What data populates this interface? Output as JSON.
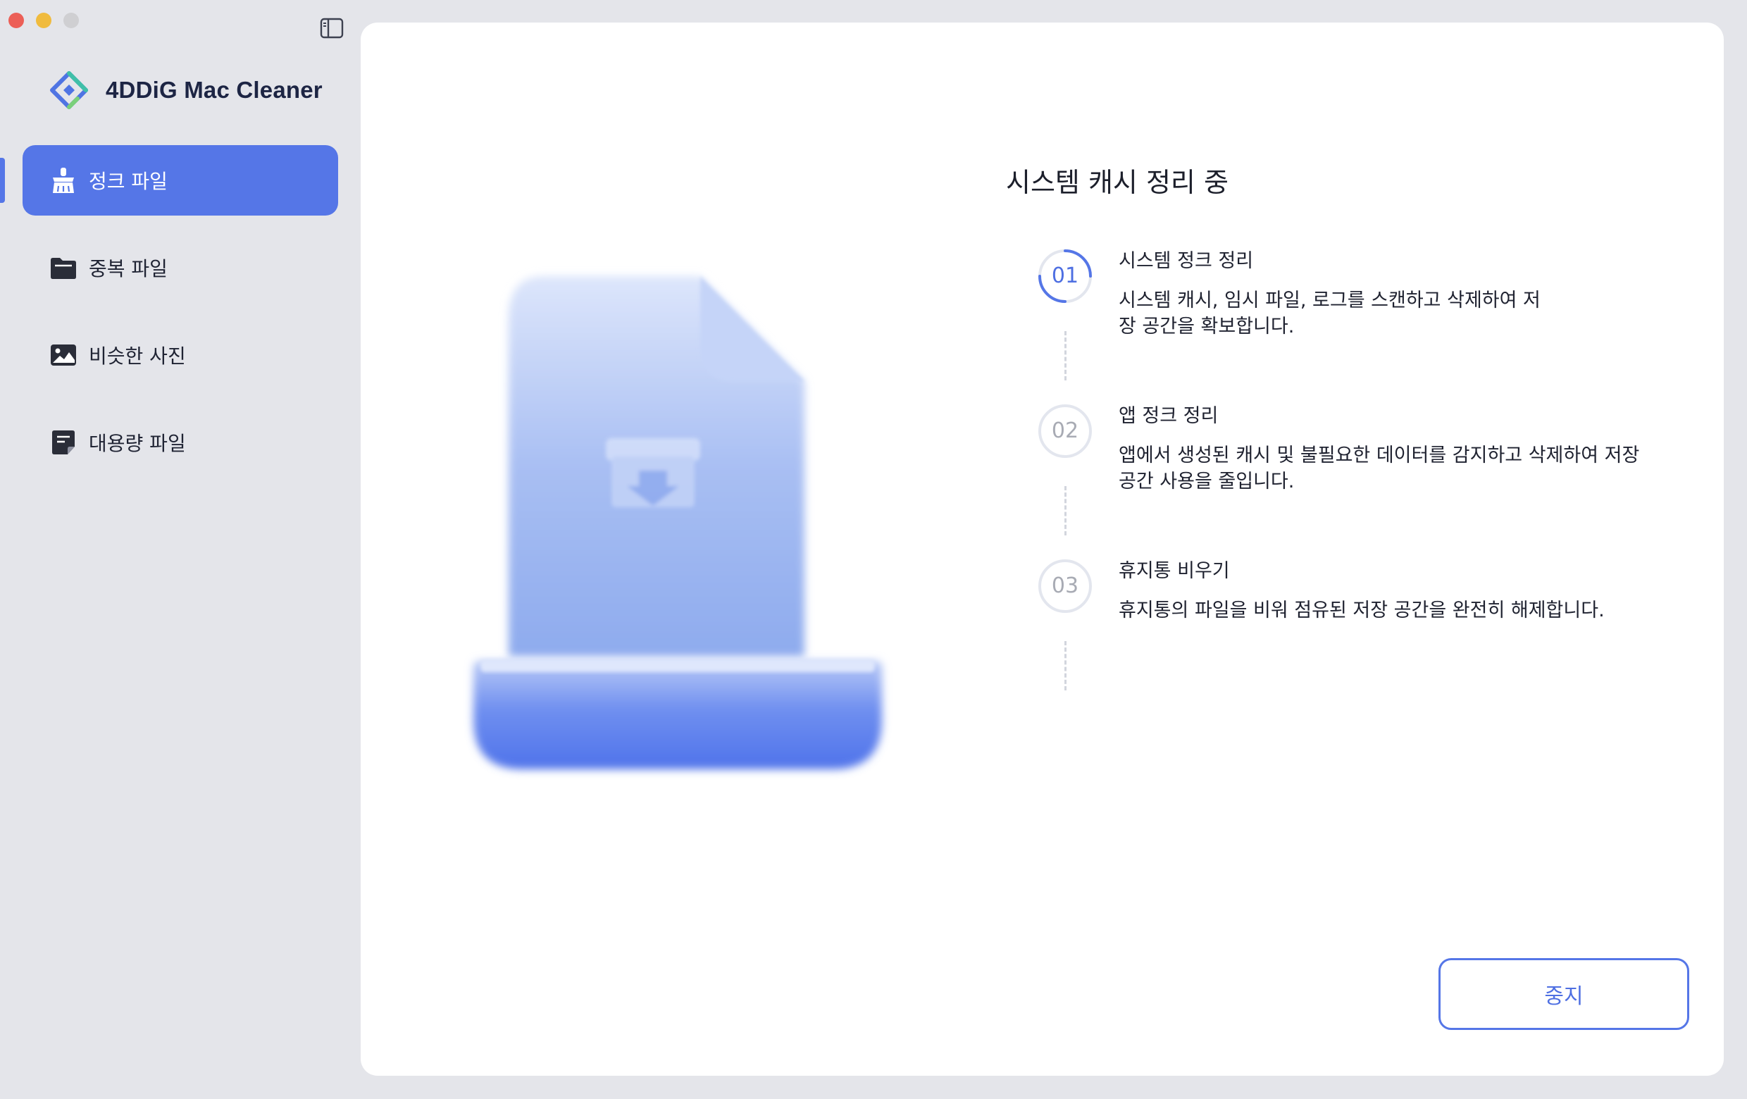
{
  "app": {
    "name": "4DDiG Mac Cleaner"
  },
  "sidebar": {
    "items": [
      {
        "label": "정크 파일",
        "icon": "broom-icon",
        "active": true
      },
      {
        "label": "중복 파일",
        "icon": "folder-icon",
        "active": false
      },
      {
        "label": "비슷한 사진",
        "icon": "photo-icon",
        "active": false
      },
      {
        "label": "대용량 파일",
        "icon": "large-file-icon",
        "active": false
      }
    ]
  },
  "main": {
    "title": "시스템 캐시 정리 중",
    "steps": [
      {
        "number": "01",
        "title": "시스템 정크 정리",
        "description": "시스템 캐시, 임시 파일, 로그를 스캔하고 삭제하여 저장 공간을 확보합니다.",
        "state": "active"
      },
      {
        "number": "02",
        "title": "앱 정크 정리",
        "description": "앱에서 생성된 캐시 및 불필요한 데이터를 감지하고 삭제하여 저장 공간 사용을 줄입니다.",
        "state": "pending"
      },
      {
        "number": "03",
        "title": "휴지통 비우기",
        "description": "휴지통의 파일을 비워 점유된 저장 공간을 완전히 해제합니다.",
        "state": "pending"
      }
    ],
    "stop_label": "중지"
  },
  "colors": {
    "accent": "#5576e7",
    "sidebar_bg": "#e4e5ea",
    "panel_bg": "#ffffff",
    "text": "#1f2230",
    "step_active": "#5576e7",
    "step_pending": "#a8abb4"
  }
}
